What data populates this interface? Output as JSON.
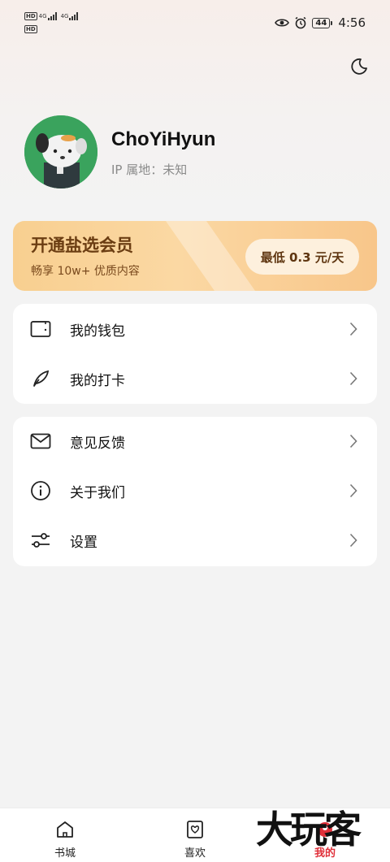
{
  "status_bar": {
    "hd_label": "HD",
    "network_1": "4G",
    "network_2": "4G",
    "battery": "44",
    "time": "4:56"
  },
  "profile": {
    "username": "ChoYiHyun",
    "ip_location": "IP 属地：未知"
  },
  "vip_banner": {
    "title": "开通盐选会员",
    "subtitle": "畅享 10w+ 优质内容",
    "price_button": "最低 0.3 元/天"
  },
  "menu_group_1": [
    {
      "label": "我的钱包",
      "icon": "wallet-icon"
    },
    {
      "label": "我的打卡",
      "icon": "feather-icon"
    }
  ],
  "menu_group_2": [
    {
      "label": "意见反馈",
      "icon": "mail-icon"
    },
    {
      "label": "关于我们",
      "icon": "info-icon"
    },
    {
      "label": "设置",
      "icon": "settings-sliders-icon"
    }
  ],
  "bottom_nav": [
    {
      "label": "书城",
      "icon": "home-icon"
    },
    {
      "label": "喜欢",
      "icon": "heart-bookmark-icon"
    },
    {
      "label": "我的",
      "icon": "profile-icon",
      "active": true
    }
  ],
  "watermark": "大玩客",
  "colors": {
    "vip_gradient_start": "#f8cf90",
    "vip_text": "#6b3d12",
    "active_nav": "#e0303a",
    "avatar_bg": "#3aa35d"
  }
}
